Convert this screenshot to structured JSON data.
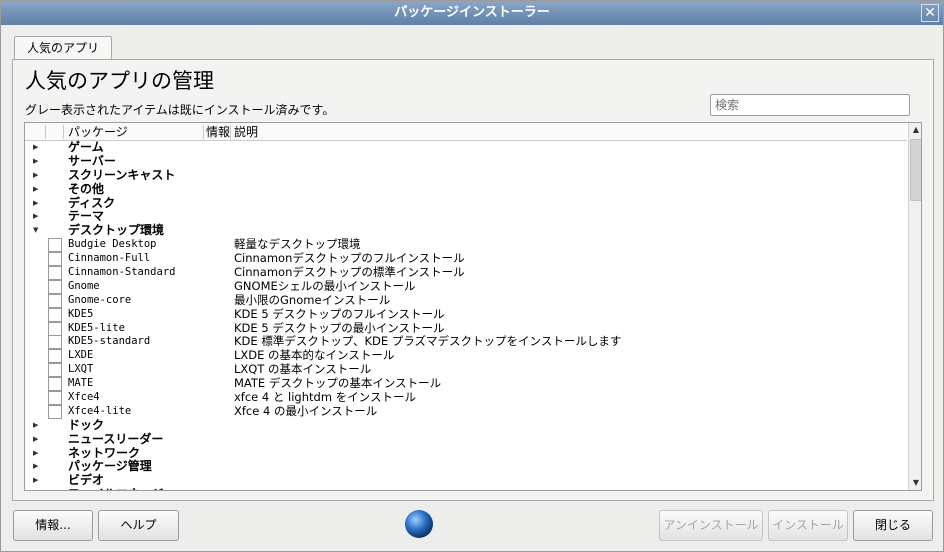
{
  "window": {
    "title": "パッケージインストーラー",
    "close_glyph": "✕"
  },
  "tab": {
    "label": "人気のアプリ"
  },
  "main": {
    "heading": "人気のアプリの管理",
    "subtext": "グレー表示されたアイテムは既にインストール済みです。",
    "search_placeholder": "検索"
  },
  "tree": {
    "columns": {
      "package": "パッケージ",
      "info": "情報",
      "description": "説明"
    },
    "categories_before": [
      {
        "label": "ゲーム"
      },
      {
        "label": "サーバー"
      },
      {
        "label": "スクリーンキャスト"
      },
      {
        "label": "その他"
      },
      {
        "label": "ディスク"
      },
      {
        "label": "テーマ"
      }
    ],
    "expanded_category": {
      "label": "デスクトップ環境"
    },
    "packages": [
      {
        "name": "Budgie Desktop",
        "description": "軽量なデスクトップ環境"
      },
      {
        "name": "Cinnamon-Full",
        "description": "Cinnamonデスクトップのフルインストール"
      },
      {
        "name": "Cinnamon-Standard",
        "description": "Cinnamonデスクトップの標準インストール"
      },
      {
        "name": "Gnome",
        "description": "GNOMEシェルの最小インストール"
      },
      {
        "name": "Gnome-core",
        "description": "最小限のGnomeインストール"
      },
      {
        "name": "KDE5",
        "description": "KDE 5 デスクトップのフルインストール"
      },
      {
        "name": "KDE5-lite",
        "description": "KDE 5 デスクトップの最小インストール"
      },
      {
        "name": "KDE5-standard",
        "description": "KDE 標準デスクトップ、KDE プラズマデスクトップをインストールします"
      },
      {
        "name": "LXDE",
        "description": "LXDE の基本的なインストール"
      },
      {
        "name": "LXQT",
        "description": "LXQT の基本インストール"
      },
      {
        "name": "MATE",
        "description": "MATE デスクトップの基本インストール"
      },
      {
        "name": "Xfce4",
        "description": "xfce 4 と lightdm をインストール"
      },
      {
        "name": "Xfce4-lite",
        "description": "Xfce 4 の最小インストール"
      }
    ],
    "categories_after": [
      {
        "label": "ドック"
      },
      {
        "label": "ニュースリーダー"
      },
      {
        "label": "ネットワーク"
      },
      {
        "label": "パッケージ管理"
      },
      {
        "label": "ビデオ"
      },
      {
        "label": "ファイルマネージャ"
      }
    ],
    "icons": {
      "collapsed": "▶",
      "expanded": "▼",
      "scroll_up": "▲",
      "scroll_down": "▼"
    }
  },
  "buttons": {
    "info": "情報...",
    "help": "ヘルプ",
    "uninstall": "アンインストール",
    "install": "インストール",
    "close": "閉じる"
  }
}
